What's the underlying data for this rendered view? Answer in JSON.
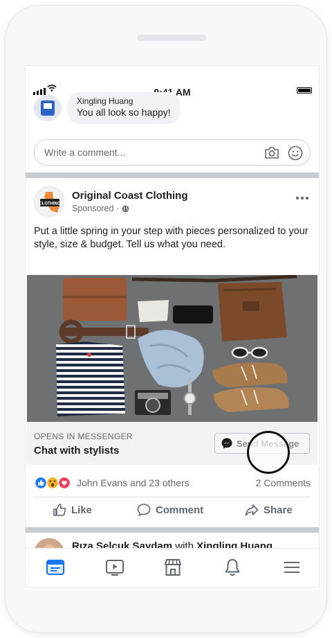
{
  "status_bar": {
    "time": "9:41 AM"
  },
  "comment": {
    "author": "Xingling Huang",
    "text": "You all look so happy!"
  },
  "comment_input": {
    "placeholder": "Write a comment..."
  },
  "post": {
    "page_name": "Original Coast Clothing",
    "sponsored_label": "Sponsored ·",
    "avatar_text": "ORIGINAL COAST CLOTHING",
    "text": "Put a little spring in your step with pieces personalized to your style, size & budget. Tell us what you need.",
    "image_alt": "flat-lay of clothing and accessories: wallet, belt, striped shirt, scarf, camera, watch, bag, sunglasses, boots",
    "cta": {
      "caption": "OPENS IN MESSENGER",
      "title": "Chat with stylists",
      "button_label": "Send Message"
    },
    "reactions": {
      "icons": [
        "like-icon",
        "wow-icon",
        "love-icon"
      ],
      "summary": "John Evans and 23 others",
      "comments": "2 Comments"
    },
    "actions": {
      "like": "Like",
      "comment": "Comment",
      "share": "Share"
    }
  },
  "next_post": {
    "author": "Rıza Selçuk Saydam",
    "with_label": "with",
    "tagged": "Xingling Huang"
  },
  "tabbar": {
    "items": [
      "news-feed-icon",
      "watch-icon",
      "marketplace-icon",
      "notifications-icon",
      "menu-icon"
    ],
    "active": "news-feed-icon"
  },
  "colors": {
    "brand_blue": "#1877f2",
    "love_red": "#f33e58",
    "wow_yellow": "#f7b125",
    "text_secondary": "#65676b"
  }
}
